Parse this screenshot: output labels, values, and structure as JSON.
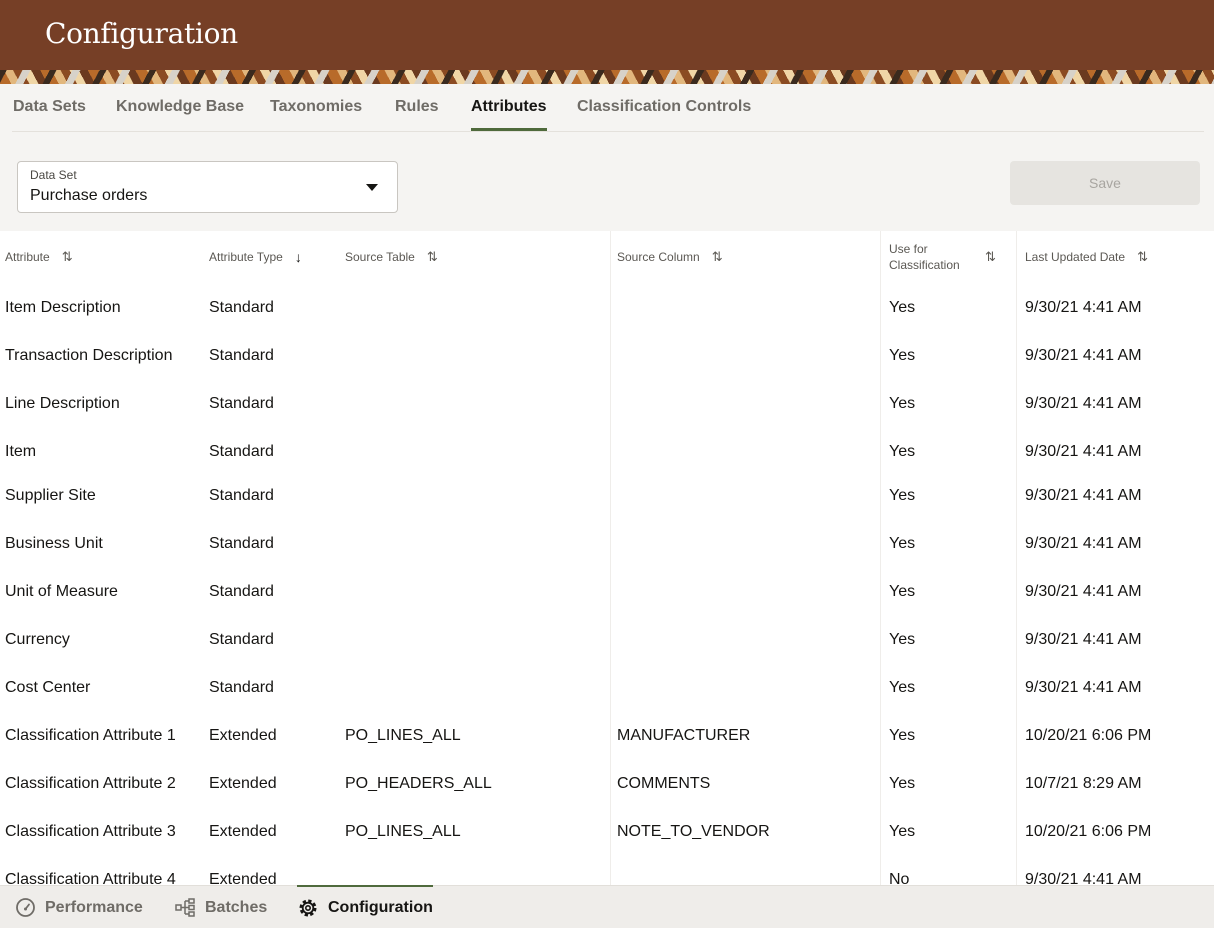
{
  "app": {
    "title": "Configuration"
  },
  "tabs": [
    {
      "label": "Data Sets",
      "active": false
    },
    {
      "label": "Knowledge Base",
      "active": false
    },
    {
      "label": "Taxonomies",
      "active": false
    },
    {
      "label": "Rules",
      "active": false
    },
    {
      "label": "Attributes",
      "active": true
    },
    {
      "label": "Classification Controls",
      "active": false
    }
  ],
  "dataset_select": {
    "label": "Data Set",
    "value": "Purchase orders"
  },
  "save_button": {
    "label": "Save",
    "disabled": true
  },
  "table": {
    "columns": [
      {
        "label": "Attribute",
        "sort": "none"
      },
      {
        "label": "Attribute Type",
        "sort": "descending"
      },
      {
        "label": "Source Table",
        "sort": "none"
      },
      {
        "label": "Source Column",
        "sort": "none"
      },
      {
        "label_line1": "Use for",
        "label_line2": "Classification",
        "sort": "none"
      },
      {
        "label": "Last Updated Date",
        "sort": "none"
      }
    ],
    "rows": [
      {
        "attribute": "Item Description",
        "type": "Standard",
        "source_table": "",
        "source_column": "",
        "use": "Yes",
        "updated": "9/30/21 4:41 AM"
      },
      {
        "attribute": "Transaction Description",
        "type": "Standard",
        "source_table": "",
        "source_column": "",
        "use": "Yes",
        "updated": "9/30/21 4:41 AM"
      },
      {
        "attribute": "Line Description",
        "type": "Standard",
        "source_table": "",
        "source_column": "",
        "use": "Yes",
        "updated": "9/30/21 4:41 AM"
      },
      {
        "attribute": "Item",
        "type": "Standard",
        "source_table": "",
        "source_column": "",
        "use": "Yes",
        "updated": "9/30/21 4:41 AM"
      },
      {
        "attribute": "Supplier Site",
        "type": "Standard",
        "source_table": "",
        "source_column": "",
        "use": "Yes",
        "updated": "9/30/21 4:41 AM"
      },
      {
        "attribute": "Business Unit",
        "type": "Standard",
        "source_table": "",
        "source_column": "",
        "use": "Yes",
        "updated": "9/30/21 4:41 AM"
      },
      {
        "attribute": "Unit of Measure",
        "type": "Standard",
        "source_table": "",
        "source_column": "",
        "use": "Yes",
        "updated": "9/30/21 4:41 AM"
      },
      {
        "attribute": "Currency",
        "type": "Standard",
        "source_table": "",
        "source_column": "",
        "use": "Yes",
        "updated": "9/30/21 4:41 AM"
      },
      {
        "attribute": "Cost Center",
        "type": "Standard",
        "source_table": "",
        "source_column": "",
        "use": "Yes",
        "updated": "9/30/21 4:41 AM"
      },
      {
        "attribute": "Classification Attribute 1",
        "type": "Extended",
        "source_table": "PO_LINES_ALL",
        "source_column": "MANUFACTURER",
        "use": "Yes",
        "updated": "10/20/21 6:06 PM"
      },
      {
        "attribute": "Classification Attribute 2",
        "type": "Extended",
        "source_table": "PO_HEADERS_ALL",
        "source_column": "COMMENTS",
        "use": "Yes",
        "updated": "10/7/21 8:29 AM"
      },
      {
        "attribute": "Classification Attribute 3",
        "type": "Extended",
        "source_table": "PO_LINES_ALL",
        "source_column": "NOTE_TO_VENDOR",
        "use": "Yes",
        "updated": "10/20/21 6:06 PM"
      },
      {
        "attribute": "Classification Attribute 4",
        "type": "Extended",
        "source_table": "",
        "source_column": "",
        "use": "No",
        "updated": "9/30/21 4:41 AM"
      }
    ]
  },
  "bottom_nav": [
    {
      "label": "Performance",
      "icon": "gauge-icon",
      "active": false
    },
    {
      "label": "Batches",
      "icon": "hierarchy-icon",
      "active": false
    },
    {
      "label": "Configuration",
      "icon": "gear-icon",
      "active": true
    }
  ],
  "colors": {
    "header": "#763f26",
    "accent": "#4f6a3c",
    "disabled_button": "#e6e4e0"
  }
}
